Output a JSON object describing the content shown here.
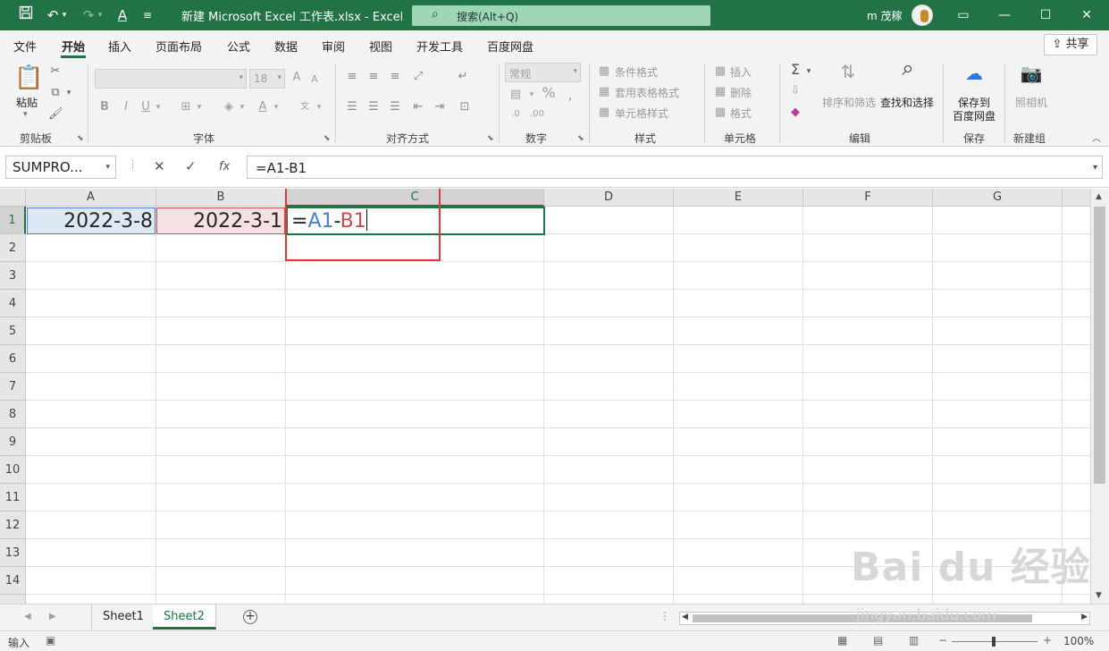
{
  "title_bar": {
    "doc_title": "新建 Microsoft Excel 工作表.xlsx  -  Excel",
    "search_placeholder": "搜索(Alt+Q)",
    "user_name": "m 茂稼"
  },
  "ribbon_tabs": [
    "文件",
    "开始",
    "插入",
    "页面布局",
    "公式",
    "数据",
    "审阅",
    "视图",
    "开发工具",
    "百度网盘"
  ],
  "share_label": "共享",
  "ribbon": {
    "clipboard": {
      "paste": "粘贴",
      "label": "剪贴板"
    },
    "font": {
      "size": "18",
      "label": "字体"
    },
    "alignment": {
      "label": "对齐方式"
    },
    "number": {
      "format": "常规",
      "label": "数字"
    },
    "styles": {
      "conditional": "条件格式",
      "table": "套用表格格式",
      "cell": "单元格样式",
      "label": "样式"
    },
    "cells": {
      "insert": "插入",
      "delete": "删除",
      "format": "格式",
      "label": "单元格"
    },
    "editing": {
      "sort": "排序和筛选",
      "find": "查找和选择",
      "label": "编辑"
    },
    "save": {
      "button": "保存到\n百度网盘",
      "line1": "保存到",
      "line2": "百度网盘",
      "label": "保存"
    },
    "new_group": {
      "camera": "照相机",
      "label": "新建组"
    }
  },
  "formula_bar": {
    "name_box": "SUMPRO...",
    "formula": "=A1-B1"
  },
  "columns": [
    "A",
    "B",
    "C",
    "D",
    "E",
    "F",
    "G"
  ],
  "rows": [
    "1",
    "2",
    "3",
    "4",
    "5",
    "6",
    "7",
    "8",
    "9",
    "10",
    "11",
    "12",
    "13",
    "14"
  ],
  "cells": {
    "A1": "2022-3-8",
    "B1": "2022-3-1",
    "C1_eq": "=",
    "C1_ref_a": "A1",
    "C1_op": "-",
    "C1_ref_b": "B1"
  },
  "sheets": [
    "Sheet1",
    "Sheet2"
  ],
  "active_sheet": "Sheet2",
  "status": {
    "mode": "输入",
    "zoom": "100%"
  },
  "watermark": {
    "main": "Bai du 经验",
    "sub": "jingyan.baidu.com"
  },
  "colors": {
    "excel_green": "#217346",
    "ref_blue": "#4e7ecb",
    "ref_red": "#c0504d",
    "highlight": "#e0373b"
  }
}
